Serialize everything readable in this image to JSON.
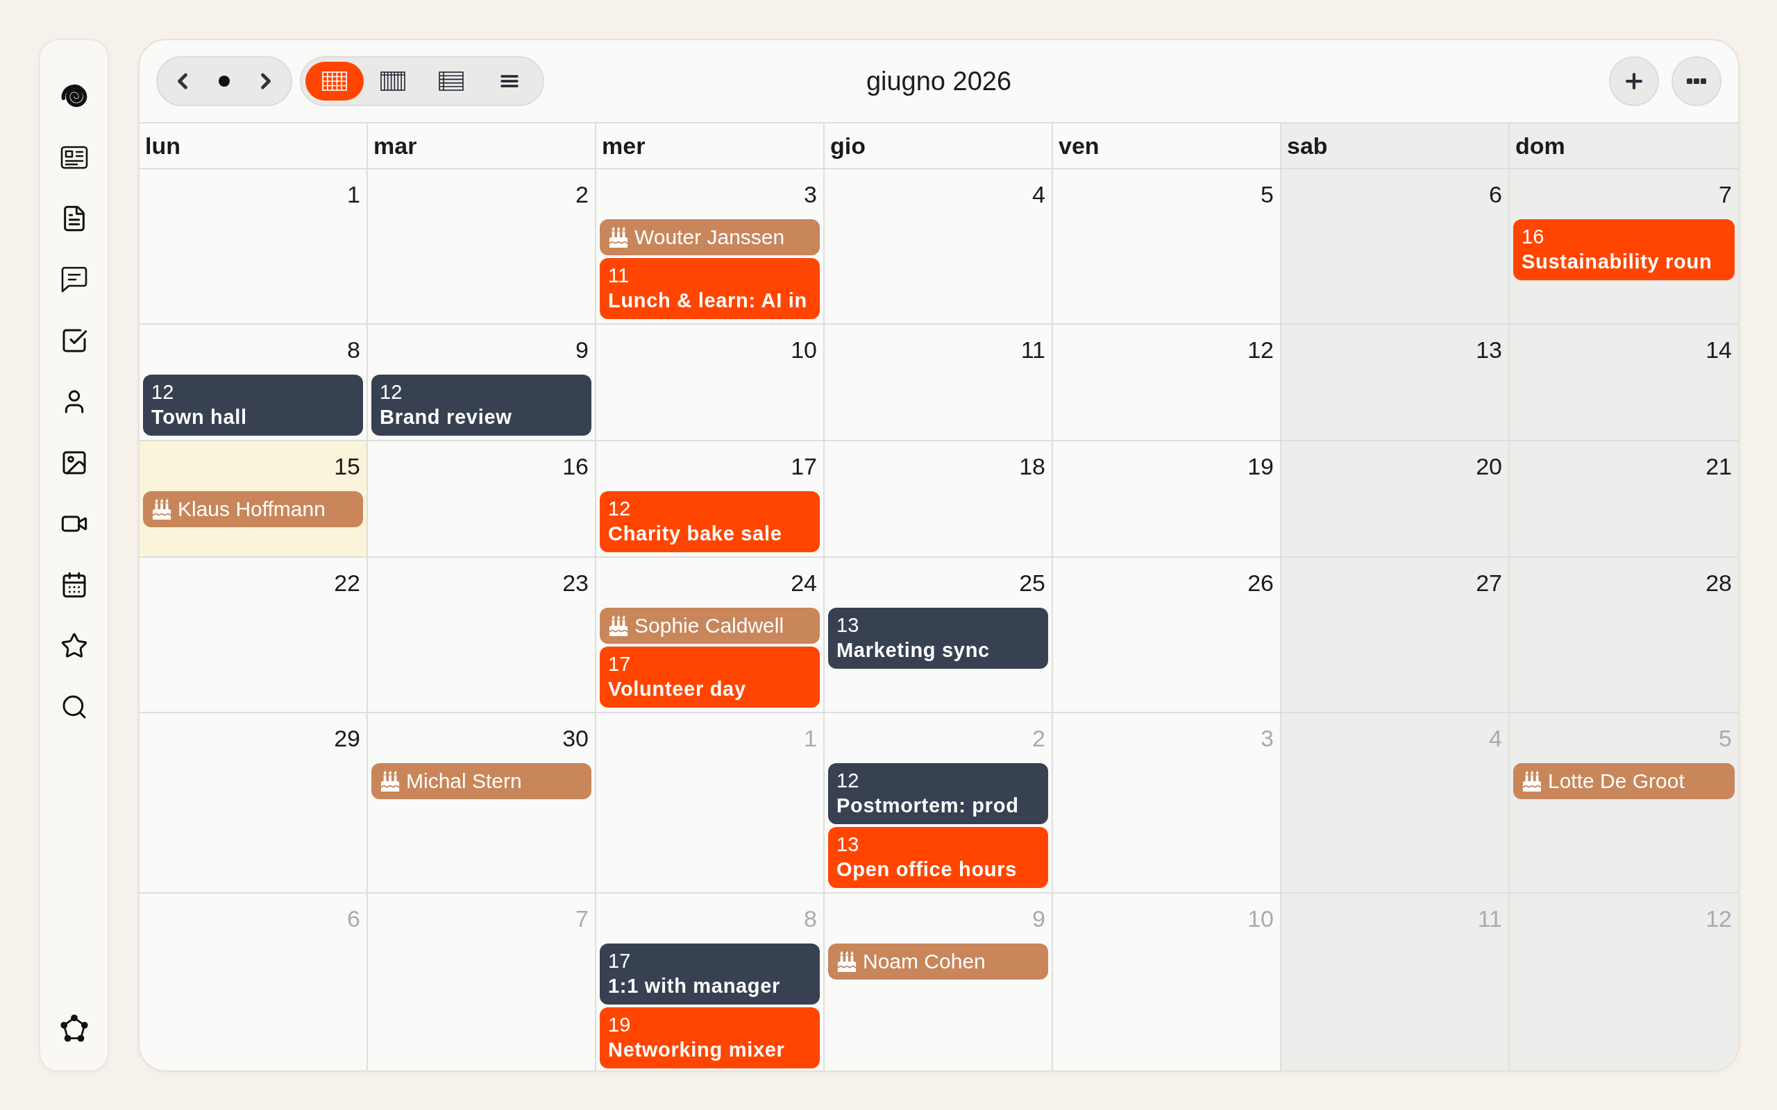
{
  "toolbar": {
    "title": "giugno 2026",
    "views": [
      {
        "kind": "month",
        "selected": true
      },
      {
        "kind": "week",
        "selected": false
      },
      {
        "kind": "table",
        "selected": false
      },
      {
        "kind": "list",
        "selected": false
      }
    ]
  },
  "calendar": {
    "weekdays": [
      {
        "label": "lun",
        "weekend": false
      },
      {
        "label": "mar",
        "weekend": false
      },
      {
        "label": "mer",
        "weekend": false
      },
      {
        "label": "gio",
        "weekend": false
      },
      {
        "label": "ven",
        "weekend": false
      },
      {
        "label": "sab",
        "weekend": true
      },
      {
        "label": "dom",
        "weekend": true
      }
    ],
    "weeks": [
      {
        "days": [
          {
            "date": "1",
            "outside_month": false,
            "today": false
          },
          {
            "date": "2",
            "outside_month": false,
            "today": false
          },
          {
            "date": "3",
            "outside_month": false,
            "today": false,
            "events": [
              {
                "kind": "birthday",
                "title": "Wouter Janssen",
                "color": "#c8865a"
              },
              {
                "kind": "timed",
                "time": "11",
                "title": "Lunch & learn: AI in",
                "color": "#ff4500"
              }
            ]
          },
          {
            "date": "4",
            "outside_month": false,
            "today": false
          },
          {
            "date": "5",
            "outside_month": false,
            "today": false
          },
          {
            "date": "6",
            "outside_month": false,
            "today": false
          },
          {
            "date": "7",
            "outside_month": false,
            "today": false,
            "events": [
              {
                "kind": "timed",
                "time": "16",
                "title": "Sustainability roun",
                "color": "#ff4500"
              }
            ]
          }
        ]
      },
      {
        "days": [
          {
            "date": "8",
            "outside_month": false,
            "today": false,
            "events": [
              {
                "kind": "timed",
                "time": "12",
                "title": "Town hall",
                "color": "#374151"
              }
            ]
          },
          {
            "date": "9",
            "outside_month": false,
            "today": false,
            "events": [
              {
                "kind": "timed",
                "time": "12",
                "title": "Brand review",
                "color": "#374151"
              }
            ]
          },
          {
            "date": "10",
            "outside_month": false,
            "today": false
          },
          {
            "date": "11",
            "outside_month": false,
            "today": false
          },
          {
            "date": "12",
            "outside_month": false,
            "today": false
          },
          {
            "date": "13",
            "outside_month": false,
            "today": false
          },
          {
            "date": "14",
            "outside_month": false,
            "today": false
          }
        ]
      },
      {
        "days": [
          {
            "date": "15",
            "outside_month": false,
            "today": true,
            "events": [
              {
                "kind": "birthday",
                "title": "Klaus Hoffmann",
                "color": "#c8865a"
              }
            ]
          },
          {
            "date": "16",
            "outside_month": false,
            "today": false
          },
          {
            "date": "17",
            "outside_month": false,
            "today": false,
            "events": [
              {
                "kind": "timed",
                "time": "12",
                "title": "Charity bake sale",
                "color": "#ff4500"
              }
            ]
          },
          {
            "date": "18",
            "outside_month": false,
            "today": false
          },
          {
            "date": "19",
            "outside_month": false,
            "today": false
          },
          {
            "date": "20",
            "outside_month": false,
            "today": false
          },
          {
            "date": "21",
            "outside_month": false,
            "today": false
          }
        ]
      },
      {
        "days": [
          {
            "date": "22",
            "outside_month": false,
            "today": false
          },
          {
            "date": "23",
            "outside_month": false,
            "today": false
          },
          {
            "date": "24",
            "outside_month": false,
            "today": false,
            "events": [
              {
                "kind": "birthday",
                "title": "Sophie Caldwell",
                "color": "#c8865a"
              },
              {
                "kind": "timed",
                "time": "17",
                "title": "Volunteer day",
                "color": "#ff4500"
              }
            ]
          },
          {
            "date": "25",
            "outside_month": false,
            "today": false,
            "events": [
              {
                "kind": "timed",
                "time": "13",
                "title": "Marketing sync",
                "color": "#374151"
              }
            ]
          },
          {
            "date": "26",
            "outside_month": false,
            "today": false
          },
          {
            "date": "27",
            "outside_month": false,
            "today": false
          },
          {
            "date": "28",
            "outside_month": false,
            "today": false
          }
        ]
      },
      {
        "days": [
          {
            "date": "29",
            "outside_month": false,
            "today": false
          },
          {
            "date": "30",
            "outside_month": false,
            "today": false,
            "events": [
              {
                "kind": "birthday",
                "title": "Michal Stern",
                "color": "#c8865a"
              }
            ]
          },
          {
            "date": "1",
            "outside_month": true,
            "today": false
          },
          {
            "date": "2",
            "outside_month": true,
            "today": false,
            "events": [
              {
                "kind": "timed",
                "time": "12",
                "title": "Postmortem: prod",
                "color": "#374151"
              },
              {
                "kind": "timed",
                "time": "13",
                "title": "Open office hours",
                "color": "#ff4500"
              }
            ]
          },
          {
            "date": "3",
            "outside_month": true,
            "today": false
          },
          {
            "date": "4",
            "outside_month": true,
            "today": false
          },
          {
            "date": "5",
            "outside_month": true,
            "today": false,
            "events": [
              {
                "kind": "birthday",
                "title": "Lotte De Groot",
                "color": "#c8865a"
              }
            ]
          }
        ]
      },
      {
        "days": [
          {
            "date": "6",
            "outside_month": true,
            "today": false
          },
          {
            "date": "7",
            "outside_month": true,
            "today": false
          },
          {
            "date": "8",
            "outside_month": true,
            "today": false,
            "events": [
              {
                "kind": "timed",
                "time": "17",
                "title": "1:1 with manager",
                "color": "#374151"
              },
              {
                "kind": "timed",
                "time": "19",
                "title": "Networking mixer",
                "color": "#ff4500"
              }
            ]
          },
          {
            "date": "9",
            "outside_month": true,
            "today": false,
            "events": [
              {
                "kind": "birthday",
                "title": "Noam Cohen",
                "color": "#c8865a"
              }
            ]
          },
          {
            "date": "10",
            "outside_month": true,
            "today": false
          },
          {
            "date": "11",
            "outside_month": true,
            "today": false
          },
          {
            "date": "12",
            "outside_month": true,
            "today": false
          }
        ]
      }
    ]
  }
}
